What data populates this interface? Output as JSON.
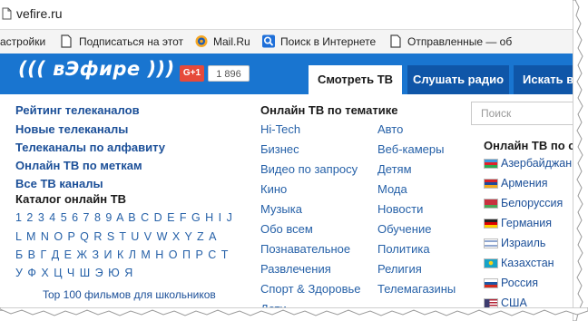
{
  "browser": {
    "url": "vefire.ru",
    "bookmarks": [
      {
        "label": "астройки",
        "icon": "none"
      },
      {
        "label": "Подписаться на этот",
        "icon": "page-icon"
      },
      {
        "label": "Mail.Ru",
        "icon": "mailru-icon"
      },
      {
        "label": "Поиск в Интернете",
        "icon": "search-icon"
      },
      {
        "label": "Отправленные — об",
        "icon": "page-icon"
      }
    ]
  },
  "header": {
    "logo": "((( вЭфире )))",
    "gplus_label": "G+1",
    "gplus_count": "1 896",
    "tabs": [
      {
        "label": "Смотреть ТВ",
        "active": true
      },
      {
        "label": "Слушать радио",
        "active": false
      },
      {
        "label": "Искать ви",
        "active": false
      }
    ]
  },
  "left": {
    "links": [
      "Рейтинг телеканалов",
      "Новые телеканалы",
      "Телеканалы по алфавиту",
      "Онлайн ТВ по меткам",
      "Все ТВ каналы"
    ],
    "catalog_title": "Каталог онлайн ТВ",
    "alphabet_rows": [
      "1 2 3 4 5 6 7 8 9 A B C D E F G H I J",
      "L M N O P Q R S T U V W X Y Z А",
      "Б В Г Д Е Ж З И К Л М Н О П Р С Т",
      "У Ф Х Ц Ч Ш Э Ю Я"
    ],
    "top100": "Top 100 фильмов для школьников"
  },
  "middle": {
    "title": "Онлайн ТВ по тематике",
    "col1": [
      "Hi-Tech",
      "Бизнес",
      "Видео по запросу",
      "Кино",
      "Музыка",
      "Обо всем",
      "Познавательное",
      "Развлечения",
      "Спорт & Здоровье",
      "Дети"
    ],
    "col2": [
      "Авто",
      "Веб-камеры",
      "Детям",
      "Мода",
      "Новости",
      "Обучение",
      "Политика",
      "Религия",
      "Телемагазины"
    ]
  },
  "right": {
    "search_placeholder": "Поиск",
    "countries_title": "Онлайн ТВ по с",
    "countries": [
      {
        "name": "Азербайджан",
        "flag": [
          "#3f9be0",
          "#e2202a",
          "#2ea851"
        ]
      },
      {
        "name": "Армения",
        "flag": [
          "#d62027",
          "#1d4a9c",
          "#f2a81e"
        ]
      },
      {
        "name": "Белоруссия",
        "flag": [
          "#c8313e",
          "#c8313e",
          "#4aa657"
        ]
      },
      {
        "name": "Германия",
        "flag": [
          "#222222",
          "#dd0000",
          "#ffce00"
        ]
      },
      {
        "name": "Израиль",
        "flag": [
          "#ffffff",
          "#1f4ea1",
          "#ffffff"
        ]
      },
      {
        "name": "Казахстан",
        "flag": [
          "#17a3c8",
          "#17a3c8",
          "#17a3c8"
        ]
      },
      {
        "name": "Россия",
        "flag": [
          "#ffffff",
          "#1c57a5",
          "#d52b1e"
        ]
      },
      {
        "name": "США",
        "flag": [
          "#b22234",
          "#ffffff",
          "#3c3b6e"
        ]
      }
    ]
  },
  "colors": {
    "header_blue": "#1975d0",
    "tab_dark": "#0f56a8",
    "link_blue": "#1b4f98"
  }
}
